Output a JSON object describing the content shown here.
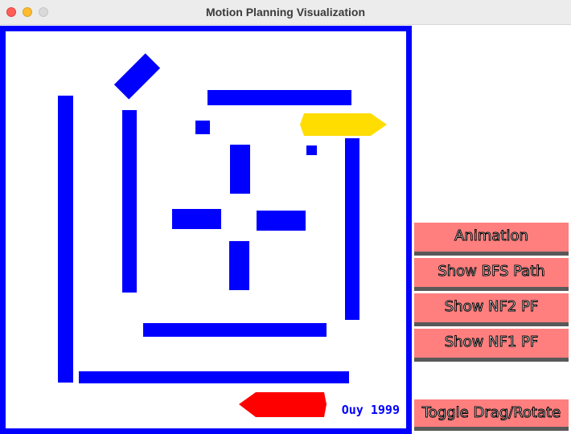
{
  "window": {
    "title": "Motion Planning Visualization"
  },
  "canvas": {
    "credit": "Ouy 1999",
    "colors": {
      "border": "#0000ff",
      "obstacle": "#0000ff",
      "robot_start": "#ffdd00",
      "robot_goal": "#ff0000"
    }
  },
  "controls": {
    "animation": "Animation",
    "show_bfs": "Show BFS Path",
    "show_nf2": "Show NF2 PF",
    "show_nf1": "Show NF1 PF",
    "toggle": "Toggle Drag/Rotate",
    "button_color": "#ff7f7f"
  }
}
